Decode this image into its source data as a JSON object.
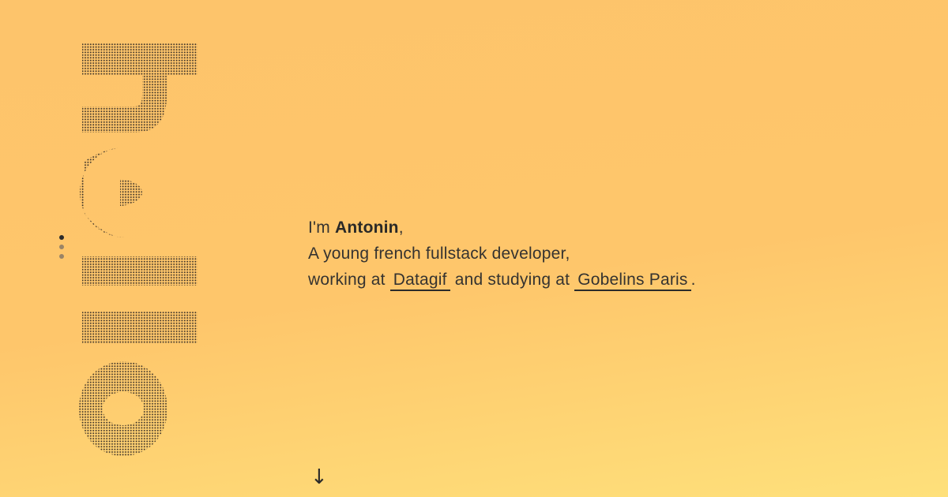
{
  "hero": {
    "word": "hello",
    "dot_color": "#3a3128"
  },
  "pager": {
    "dots": [
      {
        "state": "active"
      },
      {
        "state": "inactive"
      },
      {
        "state": "inactive"
      }
    ]
  },
  "intro": {
    "greeting_prefix": "I'm ",
    "name": "Antonin",
    "greeting_suffix": ",",
    "line2": "A young french fullstack developer,",
    "line3_prefix": "working at ",
    "company_link": "Datagif",
    "line3_middle": " and studying at ",
    "school_link": "Gobelins Paris",
    "line3_suffix": "."
  },
  "scroll": {
    "icon": "arrow-down-icon",
    "glyph": "↓"
  },
  "colors": {
    "background_top": "#fdc46b",
    "background_bottom": "#fee07b",
    "text": "#2c2b2a"
  }
}
